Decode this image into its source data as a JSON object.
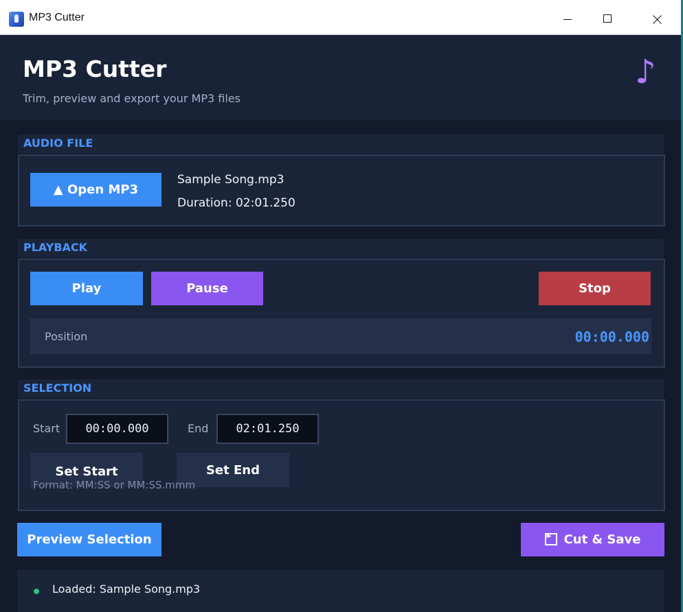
{
  "window": {
    "title": "MP3 Cutter"
  },
  "header": {
    "title": "MP3 Cutter",
    "subtitle": "Trim, preview and export your MP3 files",
    "icon": "music-note-icon"
  },
  "audio_file": {
    "section_label": "AUDIO FILE",
    "open_button": "▲ Open MP3",
    "file_name": "Sample Song.mp3",
    "duration": "Duration: 02:01.250"
  },
  "playback": {
    "section_label": "PLAYBACK",
    "play": "Play",
    "pause": "Pause",
    "stop": "Stop",
    "position_label": "Position",
    "position_value": "00:00.000"
  },
  "selection": {
    "section_label": "SELECTION",
    "start_label": "Start",
    "start_value": "00:00.000",
    "end_label": "End",
    "end_value": "02:01.250",
    "set_start": "Set Start",
    "set_end": "Set End",
    "format_hint": "Format: MM:SS or MM:SS.mmm"
  },
  "actions": {
    "preview": "Preview Selection",
    "cut_save": "Cut & Save"
  },
  "status": {
    "text": "Loaded: Sample Song.mp3",
    "color": "#2ec27e"
  },
  "colors": {
    "accent_blue": "#3b8df6",
    "accent_purple": "#8a56f0",
    "danger_red": "#b93d44",
    "background": "#121a2b"
  }
}
